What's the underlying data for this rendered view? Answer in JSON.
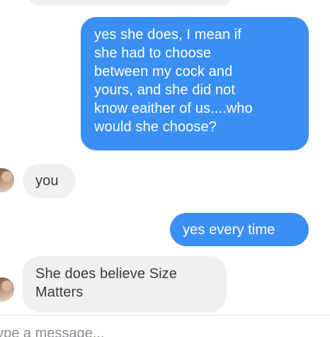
{
  "thread": {
    "messages": [
      {
        "from": "me",
        "text": ""
      },
      {
        "from": "me",
        "lines": [
          "yes she does, I mean if",
          "she had to choose",
          "between my cock and",
          "yours, and she did not",
          "know eaither of us....who",
          "would she choose?"
        ]
      },
      {
        "from": "them",
        "lines": [
          "you"
        ]
      },
      {
        "from": "me",
        "lines": [
          "yes every time"
        ]
      },
      {
        "from": "them",
        "lines": [
          "She does believe Size",
          "Matters"
        ]
      }
    ]
  },
  "composer": {
    "placeholder": "Type a message..."
  },
  "colors": {
    "outgoing_bubble": "#3a8ff2",
    "incoming_bubble": "#f1f0f0",
    "outgoing_text": "#ffffff",
    "incoming_text": "#3b3b3b"
  }
}
